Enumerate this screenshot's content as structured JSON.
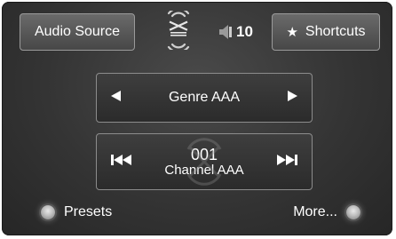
{
  "header": {
    "audio_source_label": "Audio Source",
    "shortcuts_label": "Shortcuts",
    "shortcuts_icon": "star-icon",
    "logo_icon": "siriusxm-logo-icon",
    "volume_icon": "speaker-volume-icon",
    "volume_level": "10"
  },
  "main": {
    "genre_label": "Genre AAA",
    "channel_number": "001",
    "channel_name": "Channel AAA"
  },
  "footer": {
    "presets_label": "Presets",
    "more_label": "More..."
  },
  "colors": {
    "screen_background": "#343434",
    "button_border": "#9a9a9a",
    "text": "#ffffff"
  }
}
